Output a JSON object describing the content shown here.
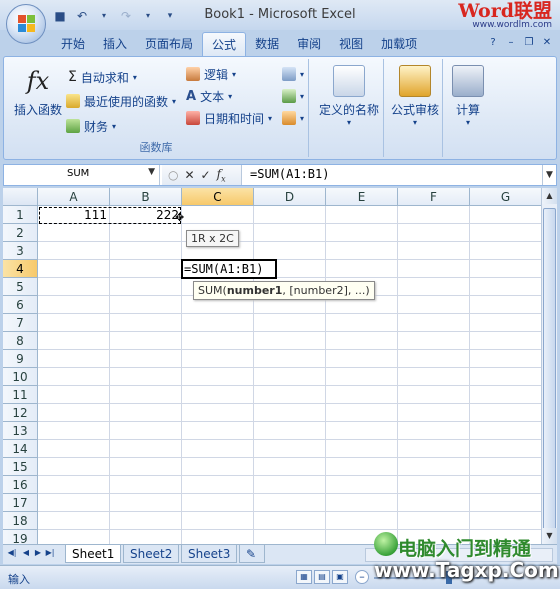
{
  "title": "Book1 - Microsoft Excel",
  "brand": {
    "name": "Word联盟",
    "url": "www.wordlm.com"
  },
  "quick_access": {
    "save": "save-icon",
    "undo": "undo-icon",
    "redo": "redo-icon",
    "customize": "customize-icon"
  },
  "tabs": [
    "开始",
    "插入",
    "页面布局",
    "公式",
    "数据",
    "审阅",
    "视图",
    "加载项"
  ],
  "active_tab": "公式",
  "ribbon": {
    "function_library": {
      "label": "函数库",
      "insert_function": "插入函数",
      "autosum": "自动求和",
      "recently_used": "最近使用的函数",
      "financial": "财务",
      "logical": "逻辑",
      "text": "文本",
      "datetime": "日期和时间"
    },
    "defined_names": "定义的名称",
    "formula_auditing": "公式审核",
    "calculation": "计算"
  },
  "formula_bar": {
    "name_box": "SUM",
    "formula": "=SUM(A1:B1)"
  },
  "columns": [
    "A",
    "B",
    "C",
    "D",
    "E",
    "F",
    "G"
  ],
  "rows": [
    "1",
    "2",
    "3",
    "4",
    "5",
    "6",
    "7",
    "8",
    "9",
    "10",
    "11",
    "12",
    "13",
    "14",
    "15",
    "16",
    "17",
    "18",
    "19"
  ],
  "cells": {
    "A1": "111",
    "B1": "222",
    "C4": "=SUM(A1:B1)"
  },
  "tooltips": {
    "range_size": "1R x 2C",
    "function_signature": {
      "name": "SUM(",
      "arg1": "number1",
      "rest": ", [number2], ...)"
    }
  },
  "sheets": [
    "Sheet1",
    "Sheet2",
    "Sheet3"
  ],
  "active_sheet": "Sheet1",
  "status": {
    "mode": "输入"
  },
  "watermark": {
    "line1": "电脑入门到精通",
    "line2": "www.Tagxp.Com"
  }
}
